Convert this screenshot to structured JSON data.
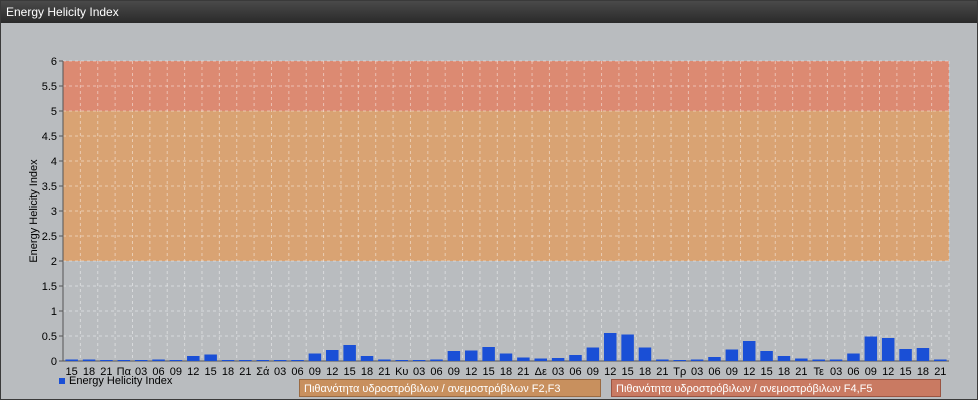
{
  "window": {
    "title": "Energy Helicity Index"
  },
  "chart_data": {
    "type": "bar",
    "title": "",
    "ylabel": "Energy Helicity Index",
    "xlabel": "",
    "ylim": [
      0,
      6
    ],
    "yticks": [
      "0",
      "0.5",
      "1",
      "1.5",
      "2",
      "2.5",
      "3",
      "3.5",
      "4",
      "4.5",
      "5",
      "5.5",
      "6"
    ],
    "grid": true,
    "categories": [
      "15",
      "18",
      "21",
      "Πα",
      "03",
      "06",
      "09",
      "12",
      "15",
      "18",
      "21",
      "Σά",
      "03",
      "06",
      "09",
      "12",
      "15",
      "18",
      "21",
      "Κυ",
      "03",
      "06",
      "09",
      "12",
      "15",
      "18",
      "21",
      "Δε",
      "03",
      "06",
      "09",
      "12",
      "15",
      "18",
      "21",
      "Τρ",
      "03",
      "06",
      "09",
      "12",
      "15",
      "18",
      "21",
      "Τε",
      "03",
      "06",
      "09",
      "12",
      "15",
      "18",
      "21"
    ],
    "series": [
      {
        "name": "Energy Helicity Index",
        "color": "#1a4fd6",
        "values": [
          0.03,
          0.03,
          0.02,
          0.02,
          0.02,
          0.03,
          0.02,
          0.1,
          0.13,
          0.02,
          0.02,
          0.02,
          0.02,
          0.02,
          0.15,
          0.22,
          0.32,
          0.1,
          0.03,
          0.02,
          0.02,
          0.03,
          0.2,
          0.21,
          0.28,
          0.15,
          0.07,
          0.05,
          0.06,
          0.12,
          0.27,
          0.56,
          0.53,
          0.27,
          0.03,
          0.02,
          0.03,
          0.08,
          0.23,
          0.4,
          0.2,
          0.1,
          0.05,
          0.03,
          0.03,
          0.15,
          0.49,
          0.46,
          0.24,
          0.26,
          0.03
        ]
      }
    ],
    "bands": [
      {
        "from": 0,
        "to": 2,
        "color": "#b9bcbf"
      },
      {
        "from": 2,
        "to": 5,
        "color": "#d9a373"
      },
      {
        "from": 5,
        "to": 6,
        "color": "#dc8a72"
      }
    ],
    "band_labels": [
      "Πιθανότητα υδροστρόβιλων / ανεμοστρόβιλων F2,F3",
      "Πιθανότητα υδροστρόβιλων / ανεμοστρόβιλων F4,F5"
    ],
    "legend_position": "bottom-left"
  }
}
